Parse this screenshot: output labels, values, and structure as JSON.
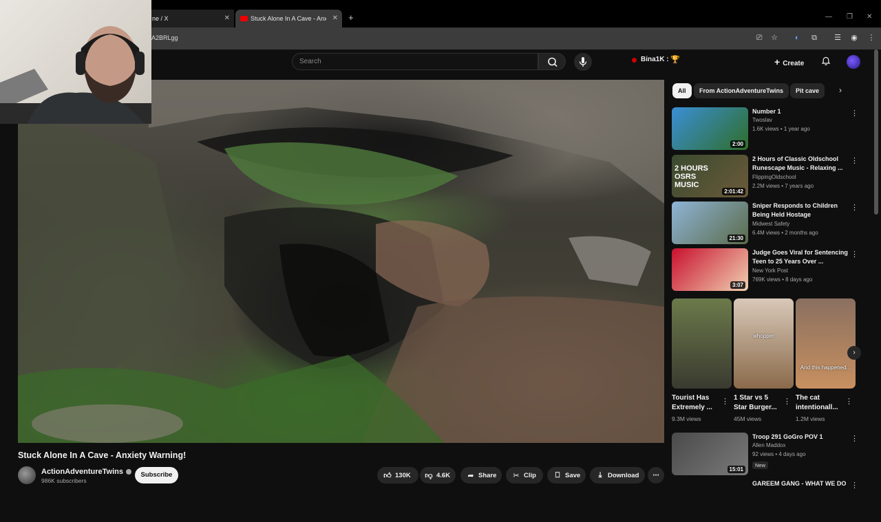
{
  "browser": {
    "tabs": [
      {
        "label": "ne / X"
      },
      {
        "label": "Stuck Alone In A Cave - Anxiety"
      }
    ],
    "new_tab": "+",
    "url": "A2BRLgg"
  },
  "header": {
    "search_placeholder": "Search",
    "live_user": "Bina1K :",
    "create_label": "Create"
  },
  "video": {
    "title": "Stuck Alone In A Cave - Anxiety Warning!",
    "channel": "ActionAdventureTwins",
    "subscribers": "986K subscribers",
    "subscribe_label": "Subscribe",
    "likes": "130K",
    "dislikes": "4.6K",
    "share_label": "Share",
    "clip_label": "Clip",
    "save_label": "Save",
    "download_label": "Download"
  },
  "sidebar": {
    "chips": [
      "All",
      "From ActionAdventureTwins",
      "Pit cave"
    ],
    "items": [
      {
        "title": "Number 1",
        "channel": "Twoslav",
        "meta": "1.6K views • 1 year ago",
        "duration": "2:00",
        "thumb_colors": [
          "#3a8fd6",
          "#2f6e2a"
        ]
      },
      {
        "title": "2 Hours of Classic Oldschool Runescape Music - Relaxing ...",
        "channel": "FlippingOldschool",
        "meta": "2.2M views • 7 years ago",
        "duration": "2:01:42",
        "thumb_text": "2 HOURS OSRS MUSIC",
        "thumb_colors": [
          "#3a4a2f",
          "#6b5a3a"
        ]
      },
      {
        "title": "Sniper Responds to Children Being Held Hostage",
        "channel": "Midwest Safety",
        "meta": "6.4M views • 2 months ago",
        "duration": "21:30",
        "thumb_colors": [
          "#8fb4d6",
          "#5a6b4a"
        ]
      },
      {
        "title": "Judge Goes Viral for Sentencing Teen to 25 Years Over ...",
        "channel": "New York Post",
        "meta": "769K views • 8 days ago",
        "duration": "3:07",
        "thumb_colors": [
          "#c8102e",
          "#f0d0b0"
        ]
      },
      {
        "title": "Troop 291 GoGro POV 1",
        "channel": "Allen Maddox",
        "meta": "92 views • 4 days ago",
        "duration": "15:01",
        "badge": "New",
        "thumb_colors": [
          "#4a4a4a",
          "#7a7a7a"
        ]
      },
      {
        "title": "GAREEM GANG - WHAT WE DO",
        "channel": "",
        "meta": "",
        "duration": ""
      }
    ],
    "shorts": [
      {
        "title": "Tourist Has Extremely ...",
        "views": "9.3M views",
        "overlay": "",
        "colors": [
          "#6b7a4a",
          "#3a3a30"
        ]
      },
      {
        "title": "1 Star vs 5 Star Burger...",
        "views": "45M views",
        "overlay": "whopper",
        "colors": [
          "#d8c8b8",
          "#8a6a4a"
        ]
      },
      {
        "title": "The cat intentionall...",
        "views": "1.2M views",
        "overlay": "And this happened...",
        "colors": [
          "#8a7060",
          "#c89060"
        ]
      }
    ]
  }
}
